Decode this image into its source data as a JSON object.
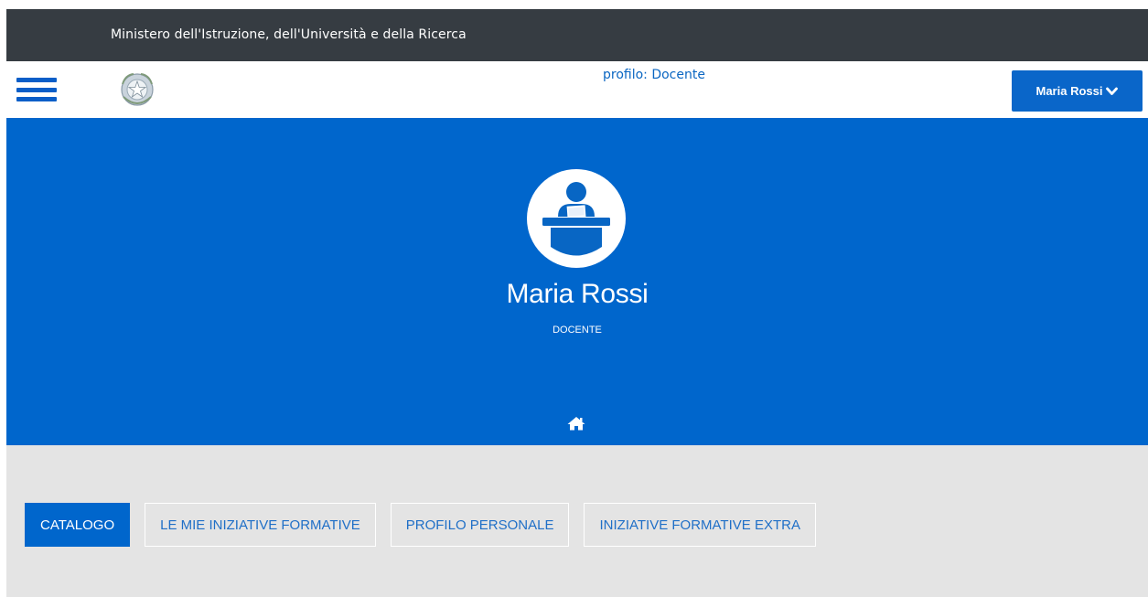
{
  "topbar": {
    "ministry": "Ministero dell'Istruzione, dell'Università e della Ricerca"
  },
  "header": {
    "menu_icon": "hamburger-icon",
    "emblem_icon": "italian-republic-emblem",
    "profile_label": "profilo: Docente",
    "user_button": {
      "label": "Maria Rossi",
      "icon": "chevron-down-icon"
    }
  },
  "hero": {
    "avatar_icon": "teacher-at-desk-icon",
    "name": "Maria Rossi",
    "role": "DOCENTE",
    "home_icon": "home-icon"
  },
  "tabs": [
    {
      "label": "CATALOGO",
      "active": true
    },
    {
      "label": "LE MIE INIZIATIVE FORMATIVE",
      "active": false
    },
    {
      "label": "PROFILO PERSONALE",
      "active": false
    },
    {
      "label": "INIZIATIVE FORMATIVE EXTRA",
      "active": false
    }
  ],
  "colors": {
    "topbar": "#363c42",
    "primary_blue": "#0066cc",
    "tabs_background": "#e4e4e4"
  }
}
